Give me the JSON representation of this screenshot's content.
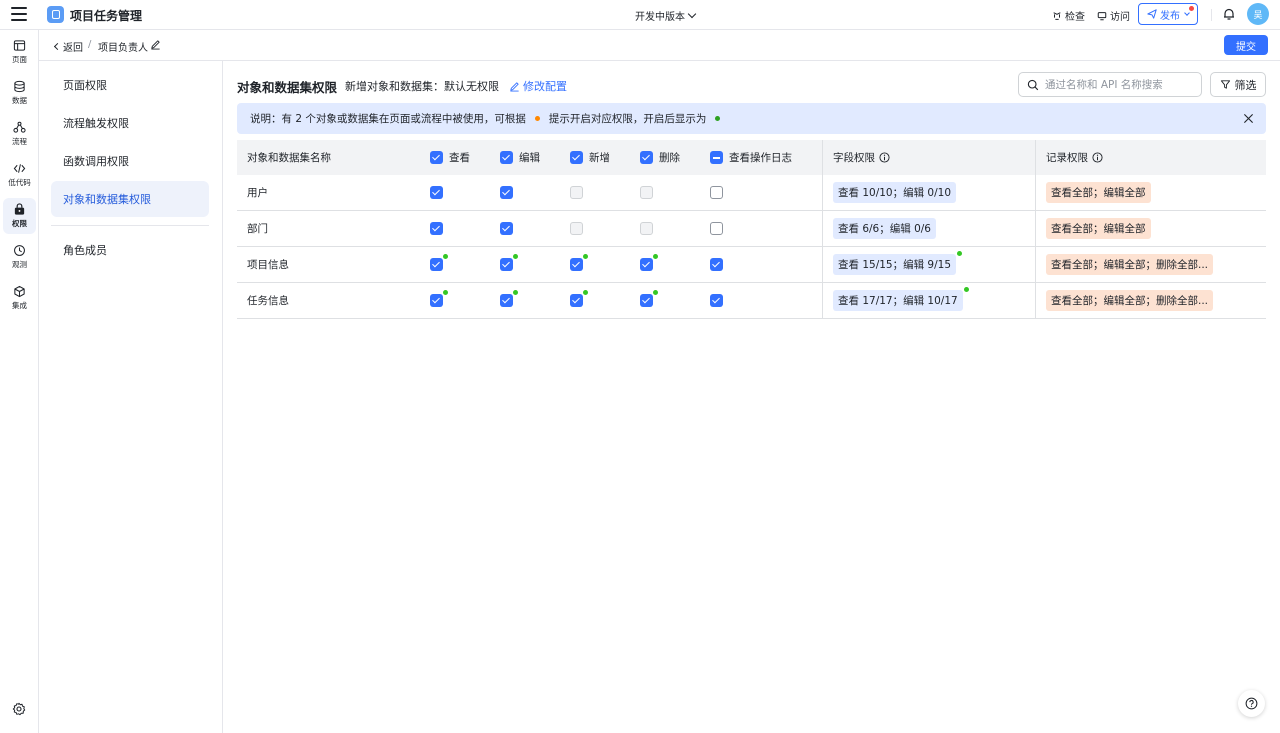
{
  "app": {
    "title": "项目任务管理",
    "version": "开发中版本"
  },
  "topbar": {
    "inspect": "检查",
    "visit": "访问",
    "publish": "发布",
    "avatar": "吴"
  },
  "nav": [
    {
      "label": "页面",
      "icon": "page-icon"
    },
    {
      "label": "数据",
      "icon": "database-icon"
    },
    {
      "label": "流程",
      "icon": "flow-icon"
    },
    {
      "label": "低代码",
      "icon": "code-icon"
    },
    {
      "label": "权限",
      "icon": "lock-icon",
      "active": true
    },
    {
      "label": "观测",
      "icon": "monitor-icon"
    },
    {
      "label": "集成",
      "icon": "integration-icon"
    }
  ],
  "breadcrumb": {
    "back": "返回",
    "separator": "/",
    "current": "项目负责人",
    "submit": "提交"
  },
  "side_menu": [
    "页面权限",
    "流程触发权限",
    "函数调用权限",
    "对象和数据集权限",
    "角色成员"
  ],
  "header": {
    "title": "对象和数据集权限",
    "default_text": "新增对象和数据集：默认无权限",
    "modify": "修改配置",
    "search_placeholder": "通过名称和 API 名称搜索",
    "filter": "筛选"
  },
  "notice": {
    "part1": "说明：有 2 个对象或数据集在页面或流程中被使用，可根据",
    "part2": "提示开启对应权限，开启后显示为"
  },
  "table": {
    "columns": {
      "name": "对象和数据集名称",
      "view": "查看",
      "edit": "编辑",
      "add": "新增",
      "delete": "删除",
      "log": "查看操作日志",
      "field": "字段权限",
      "record": "记录权限"
    },
    "rows": [
      {
        "name": "用户",
        "field": "查看 10/10；编辑 0/10",
        "record": "查看全部；编辑全部"
      },
      {
        "name": "部门",
        "field": "查看 6/6；编辑 0/6",
        "record": "查看全部；编辑全部"
      },
      {
        "name": "项目信息",
        "field": "查看 15/15；编辑 9/15",
        "record": "查看全部；编辑全部；删除全部..."
      },
      {
        "name": "任务信息",
        "field": "查看 17/17；编辑 10/17",
        "record": "查看全部；编辑全部；删除全部..."
      }
    ]
  },
  "colors": {
    "accent": "#3370ff",
    "notice_bg": "#e1eaff",
    "tag_orange": "#fde2d2",
    "dot_green": "#34c724",
    "dot_orange": "#ff8800"
  }
}
